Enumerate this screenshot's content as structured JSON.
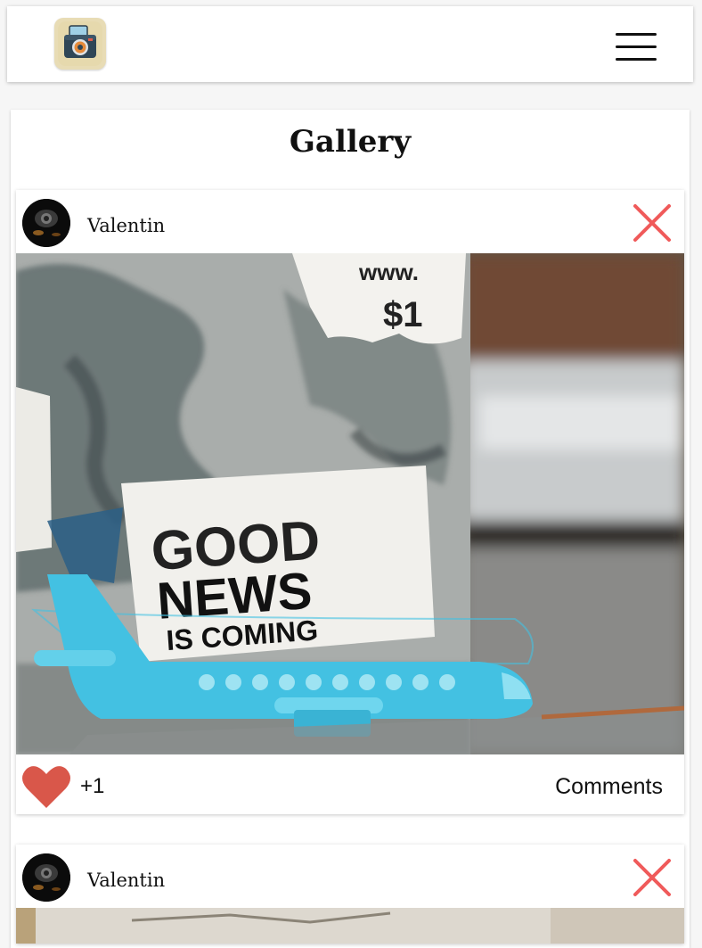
{
  "header": {
    "logo_icon": "camera-icon",
    "menu_icon": "hamburger-menu-icon"
  },
  "gallery": {
    "title": "Gallery",
    "posts": [
      {
        "author": "Valentin",
        "image": {
          "poster_headline": [
            "GOOD",
            "NEWS",
            "IS COMING"
          ],
          "poster_torn": [
            "www.",
            "$1"
          ]
        },
        "likes": "+1",
        "comments_label": "Comments"
      },
      {
        "author": "Valentin"
      }
    ]
  },
  "colors": {
    "accent_red": "#f05a5a",
    "heart": "#d9574a",
    "plane": "#43c1e2"
  }
}
